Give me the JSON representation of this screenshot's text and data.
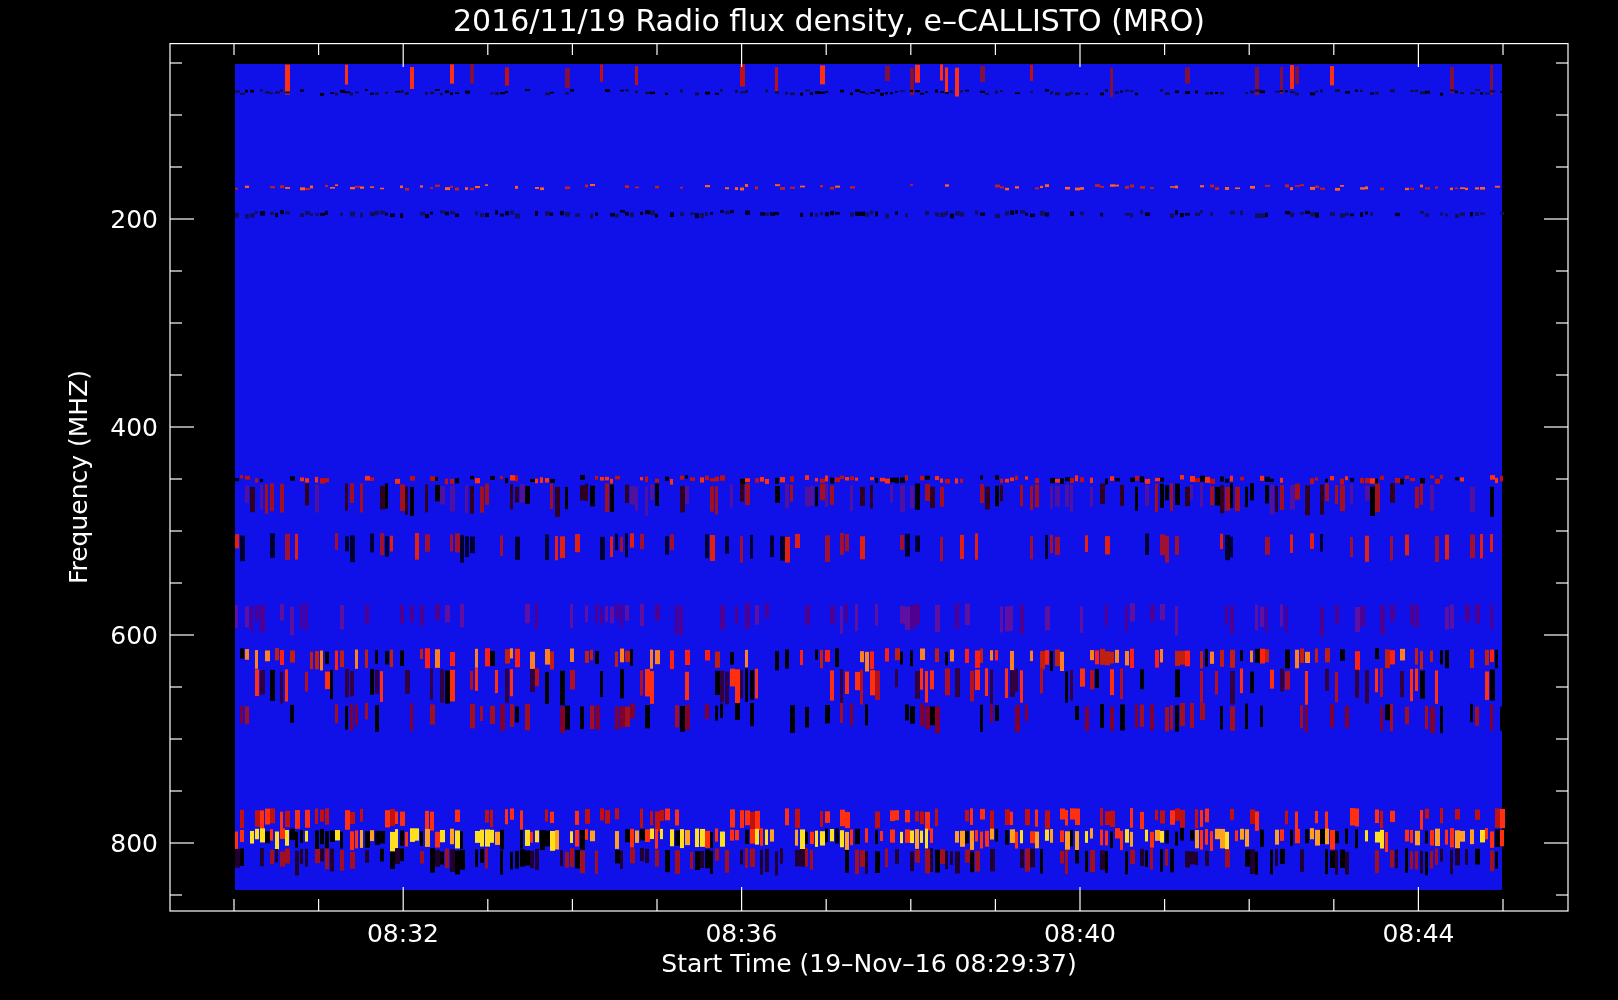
{
  "title": "2016/11/19  Radio flux density, e–CALLISTO (MRO)",
  "y_axis": {
    "label": "Frequency (MHZ)",
    "ticks": [
      "200",
      "400",
      "600",
      "800"
    ]
  },
  "x_axis": {
    "label": "Start Time (19–Nov–16 08:29:37)",
    "ticks": [
      "08:32",
      "08:36",
      "08:40",
      "08:44"
    ]
  }
}
